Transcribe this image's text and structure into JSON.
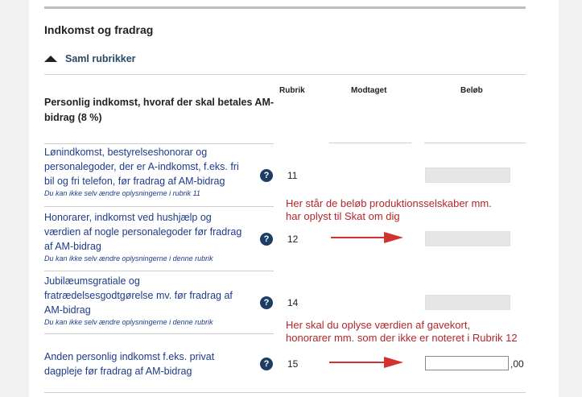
{
  "section": {
    "title": "Indkomst og fradrag",
    "collapse_label": "Saml rubrikker"
  },
  "columns": {
    "rubrik": "Rubrik",
    "modtaget": "Modtaget",
    "beloeb": "Beløb"
  },
  "group": {
    "heading": "Personlig indkomst, hvoraf der skal betales AM-bidrag (8 %)"
  },
  "rows": [
    {
      "label_lines": [
        "Lønindkomst, bestyrelseshonorar og",
        "personalegoder, der er A-indkomst, f.eks. fri",
        "bil og fri telefon, før fradrag af AM-bidrag"
      ],
      "note": "Du kan ikke selv ændre oplysningerne i rubrik 11",
      "rubrik": "11"
    },
    {
      "label_lines": [
        "Honorarer, indkomst ved hushjælp og",
        "værdien af nogle personalegoder før fradrag",
        "af AM-bidrag"
      ],
      "note": "Du kan ikke selv ændre oplysningerne i denne rubrik",
      "rubrik": "12"
    },
    {
      "label_lines": [
        "Jubilæumsgratiale og",
        "fratrædelsesgodtgørelse mv. før fradrag af",
        "AM-bidrag"
      ],
      "note": "Du kan ikke selv ændre oplysningerne i denne rubrik",
      "rubrik": "14"
    },
    {
      "label_lines": [
        "Anden personlig indkomst f.eks. privat",
        "dagpleje før fradrag af AM-bidrag"
      ],
      "rubrik": "15",
      "input_value": "",
      "suffix": ",00"
    }
  ],
  "help_glyph": "?",
  "annotations": {
    "first": [
      "Her står de beløb produktionsselskaber mm.",
      "har oplyst til Skat om dig"
    ],
    "second": [
      "Her skal du oplyse værdien af gavekort,",
      "honorarer mm. som der ikke er noteret i Rubrik 12"
    ]
  },
  "colors": {
    "annotation_red": "#b3262a",
    "arrow_red": "#d43131",
    "link_blue": "#1e3b8a",
    "help_icon": "#1c3d64"
  }
}
